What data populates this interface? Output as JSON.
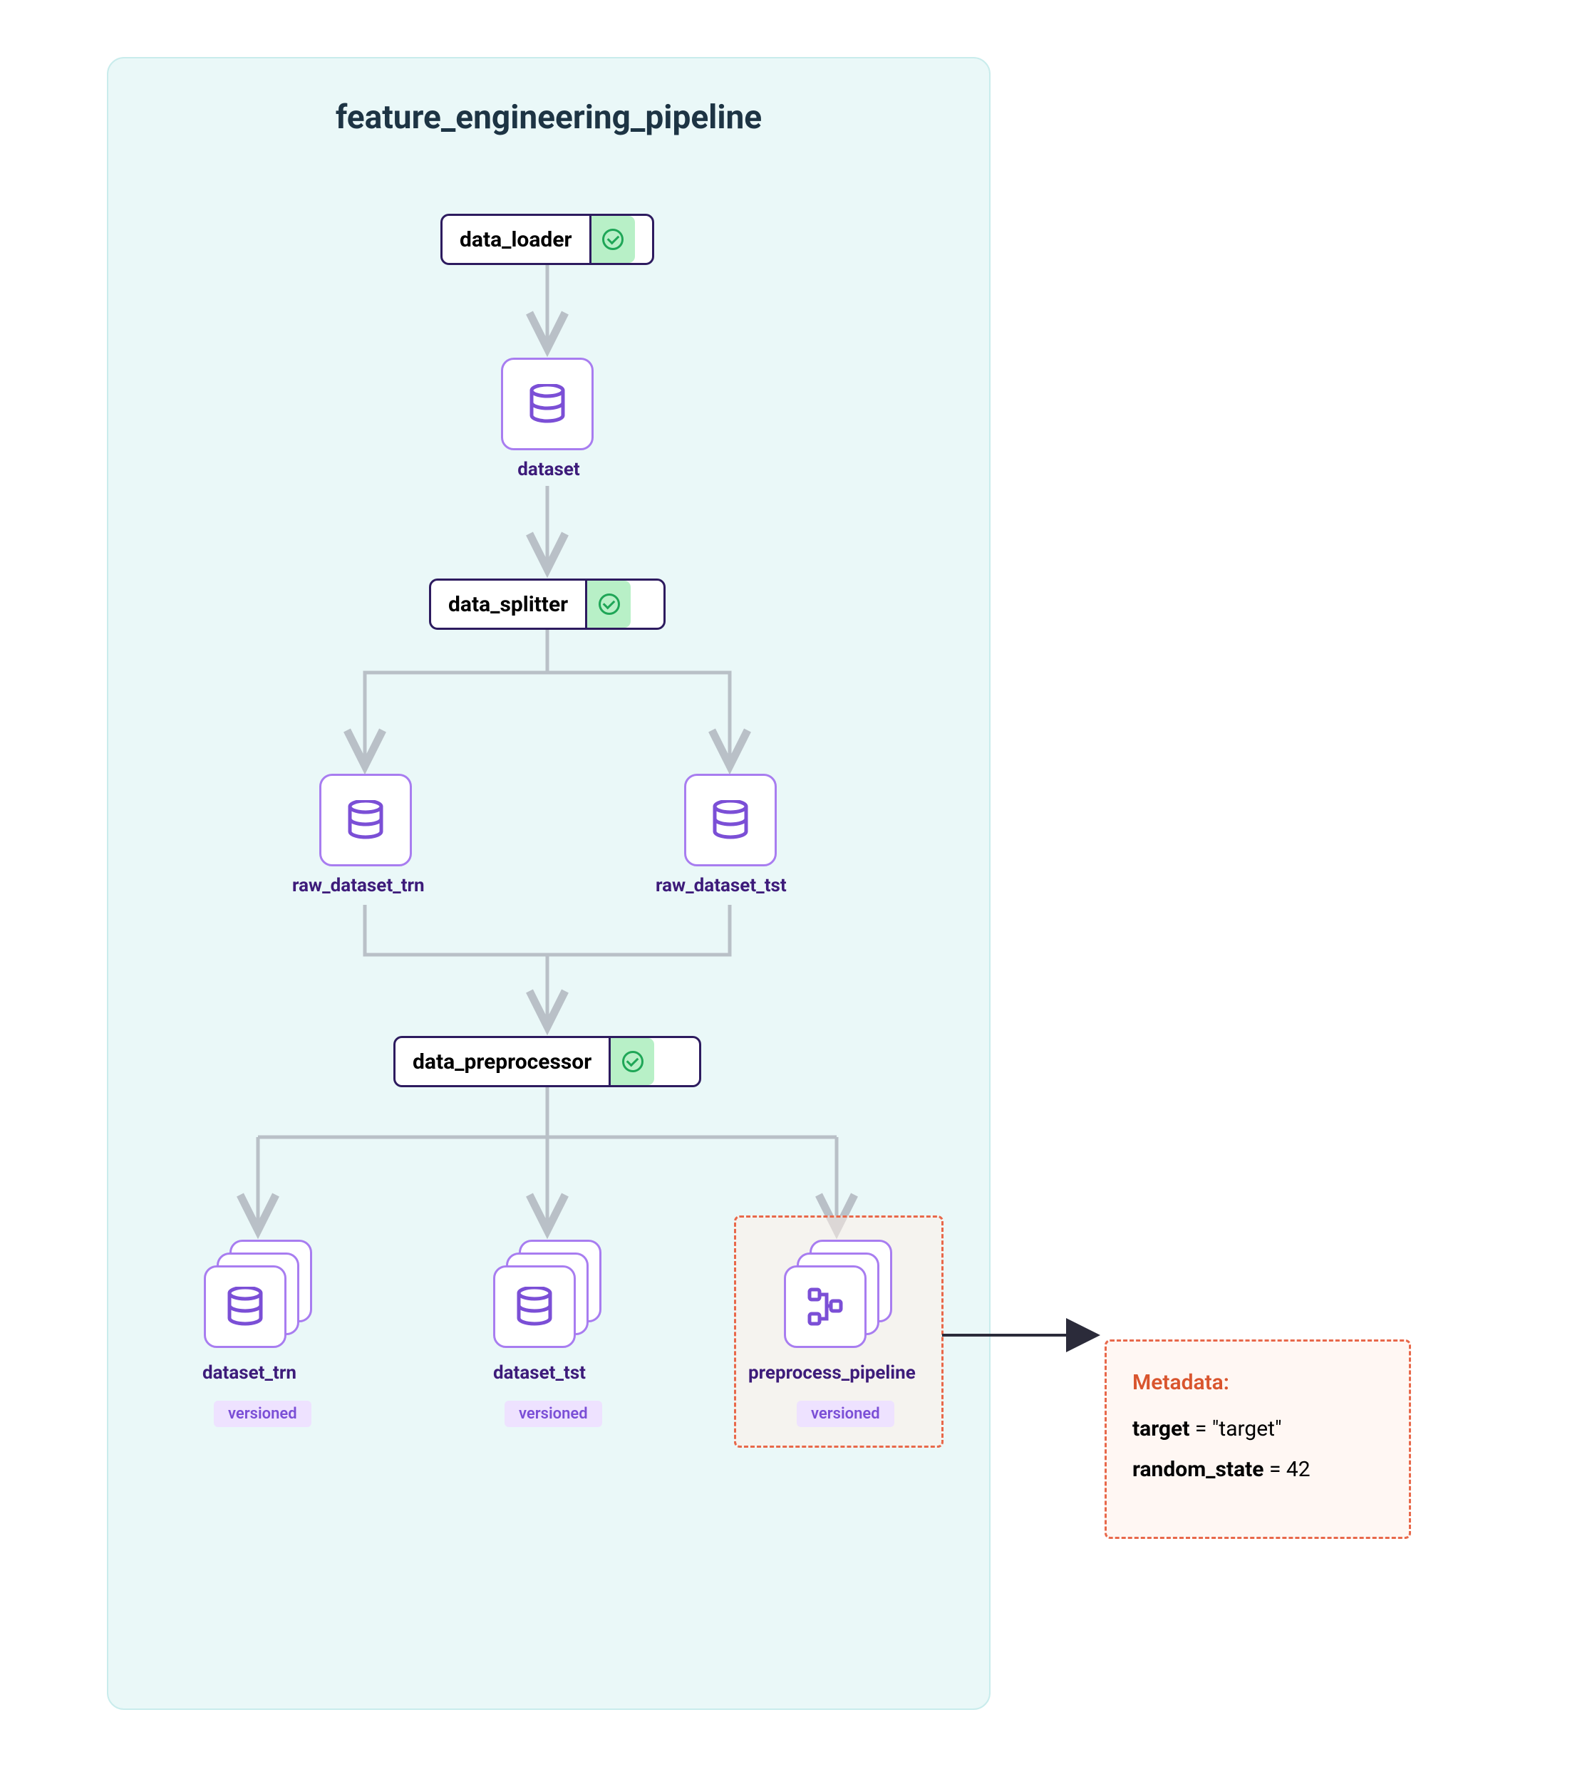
{
  "pipeline": {
    "title": "feature_engineering_pipeline",
    "steps": {
      "data_loader": {
        "label": "data_loader"
      },
      "data_splitter": {
        "label": "data_splitter"
      },
      "data_preprocessor": {
        "label": "data_preprocessor"
      }
    },
    "artifacts": {
      "dataset": {
        "label": "dataset"
      },
      "raw_dataset_trn": {
        "label": "raw_dataset_trn"
      },
      "raw_dataset_tst": {
        "label": "raw_dataset_tst"
      },
      "dataset_trn": {
        "label": "dataset_trn",
        "badge": "versioned"
      },
      "dataset_tst": {
        "label": "dataset_tst",
        "badge": "versioned"
      },
      "preprocess_pipeline": {
        "label": "preprocess_pipeline",
        "badge": "versioned"
      }
    }
  },
  "metadata": {
    "heading": "Metadata:",
    "rows": [
      {
        "key": "target",
        "value": "\"target\""
      },
      {
        "key": "random_state",
        "value": "42"
      }
    ]
  },
  "colors": {
    "artifact_border": "#a87df0",
    "step_border": "#2d1b5f",
    "status_bg": "#b8f0c7",
    "status_check": "#1fa657",
    "highlight": "#e8684a",
    "purple_text": "#3d1b7a",
    "badge_bg": "#eee2ff",
    "badge_text": "#7b4fd6"
  }
}
